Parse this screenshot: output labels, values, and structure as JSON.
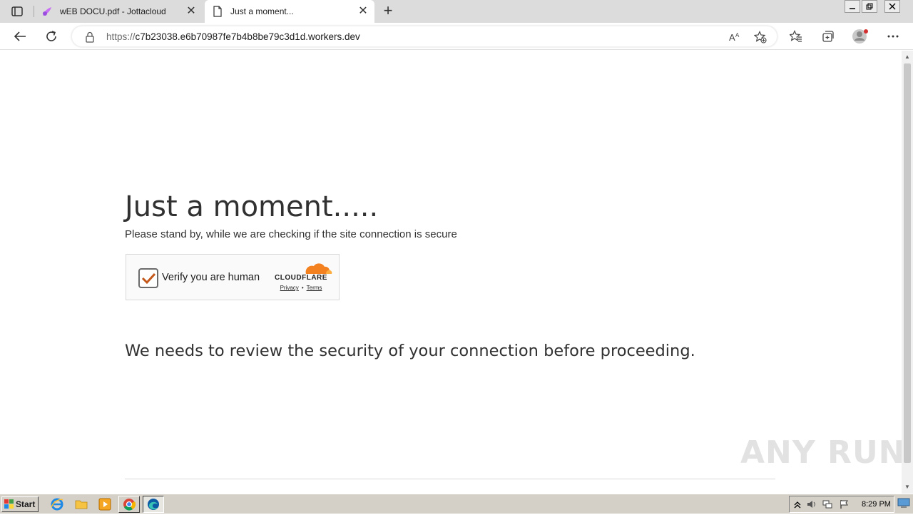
{
  "browser": {
    "tabs": [
      {
        "label": "wEB DOCU.pdf - Jottacloud",
        "active": false
      },
      {
        "label": "Just a moment...",
        "active": true
      }
    ],
    "url_protocol": "https://",
    "url_host": "c7b23038.e6b70987fe7b4b8be79c3d1d.workers.dev"
  },
  "page": {
    "title": "Just a moment.....",
    "subtitle": "Please stand by, while we are checking if the site connection is secure",
    "captcha": {
      "label": "Verify you are human",
      "brand": "CLOUDFLARE",
      "privacy": "Privacy",
      "separator": "•",
      "terms": "Terms",
      "checked": true
    },
    "notice": "We needs to review the security of your connection before proceeding.",
    "watermark": "ANY RUN"
  },
  "taskbar": {
    "start_label": "Start",
    "clock": "8:29 PM"
  },
  "colors": {
    "check_mark": "#c4581a",
    "cloudflare_orange": "#f48120",
    "cloudflare_light": "#fbad41",
    "jotta_icon": "#c86ef5"
  },
  "icons": [
    "tab-actions-icon",
    "jottacloud-icon",
    "page-icon",
    "close-icon",
    "plus-icon",
    "back-arrow-icon",
    "refresh-icon",
    "lock-icon",
    "read-aloud-icon",
    "favorite-add-icon",
    "favorites-icon",
    "collections-icon",
    "profile-avatar-icon",
    "more-icon",
    "ie-icon",
    "folder-icon",
    "media-player-icon",
    "chrome-icon",
    "edge-icon",
    "show-hidden-icons",
    "volume-icon",
    "network-icon",
    "flag-icon",
    "show-desktop-icon"
  ]
}
